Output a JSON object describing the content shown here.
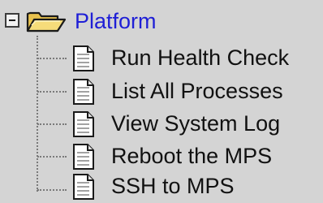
{
  "tree": {
    "root": {
      "label": "Platform",
      "expander_icon": "minus-box-icon",
      "icon": "open-folder-icon",
      "expanded": true
    },
    "items": [
      {
        "label": "Run Health Check",
        "icon": "document-icon"
      },
      {
        "label": "List All Processes",
        "icon": "document-icon"
      },
      {
        "label": "View System Log",
        "icon": "document-icon"
      },
      {
        "label": "Reboot the MPS",
        "icon": "document-icon"
      },
      {
        "label": "SSH to MPS",
        "icon": "document-icon"
      }
    ]
  },
  "colors": {
    "background": "#d4d4d4",
    "root_label": "#1f1fd6",
    "item_label": "#111111",
    "folder_fill": "#f2d36b",
    "folder_outline": "#1a1a1a",
    "connector": "#7a7a7a"
  }
}
